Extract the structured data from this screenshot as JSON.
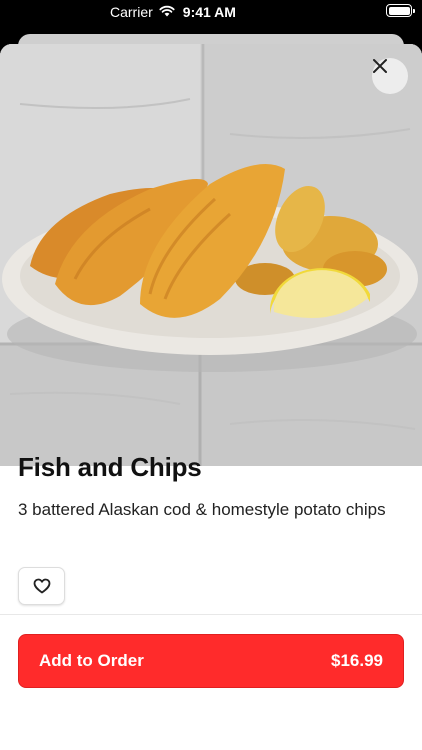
{
  "status_bar": {
    "carrier": "Carrier",
    "time": "9:41 AM",
    "icons": [
      "wifi-icon",
      "battery-icon"
    ]
  },
  "item": {
    "name": "Fish and Chips",
    "description": "3 battered Alaskan cod & homestyle potato chips",
    "image": "fish-and-chips-photo"
  },
  "actions": {
    "close_icon": "close-icon",
    "favorite_icon": "heart-icon",
    "add_label": "Add to Order",
    "price": "$16.99"
  },
  "colors": {
    "accent": "#ff2b2b",
    "text": "#111111"
  }
}
